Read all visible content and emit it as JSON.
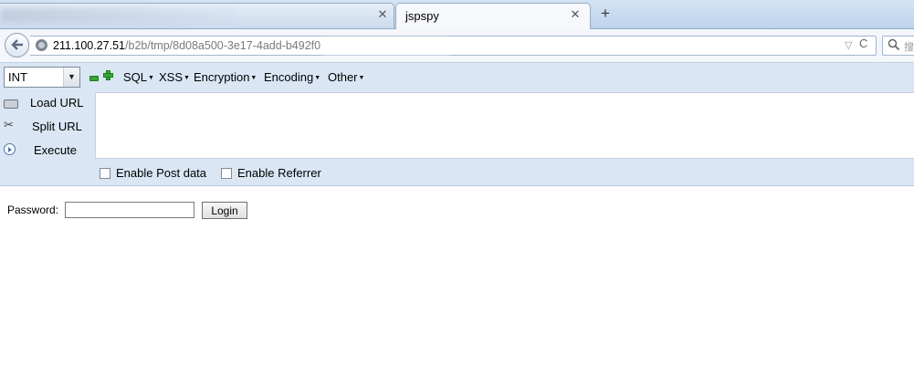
{
  "browser": {
    "tabs": [
      {
        "title": "",
        "close_glyph": "✕"
      },
      {
        "title": "jspspy",
        "close_glyph": "✕"
      }
    ],
    "new_tab_glyph": "+",
    "url": {
      "host": "211.100.27.51",
      "path": "/b2b/tmp/8d08a500-3e17-4add-b4",
      "path_tail": "92f0"
    },
    "dropdown_glyph": "▽",
    "reload_glyph": "C",
    "search_glyph": "搜"
  },
  "hackbar": {
    "select_value": "INT",
    "menus": [
      "SQL",
      "XSS",
      "Encryption",
      "Encoding",
      "Other"
    ],
    "actions": {
      "load": "Load URL",
      "split": "Split URL",
      "execute": "Execute"
    },
    "options": {
      "post": "Enable Post data",
      "referrer": "Enable Referrer"
    }
  },
  "login": {
    "password_label": "Password:",
    "password_value": "",
    "login_button": "Login"
  },
  "icons": {
    "back": "back-arrow-icon",
    "site": "globe-icon",
    "search": "magnifier-icon",
    "minus": "minus-icon",
    "plus": "plus-icon",
    "load": "load-url-icon",
    "split": "scissors-icon",
    "execute": "play-icon"
  },
  "colors": {
    "hackbar_bg": "#dae6f4",
    "tabstrip_bg": "#bdd2ea",
    "green": "#39a53a"
  }
}
